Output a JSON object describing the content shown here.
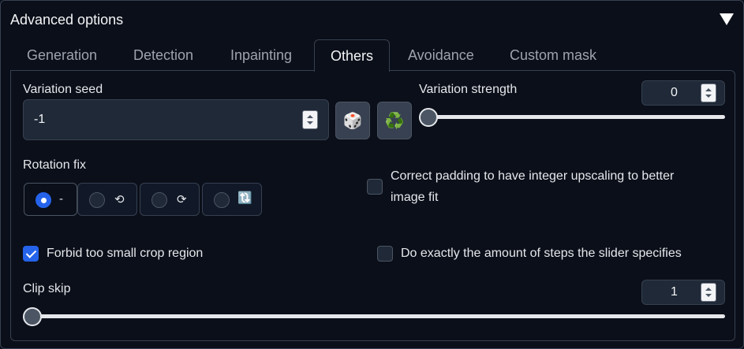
{
  "panel": {
    "title": "Advanced options",
    "collapse_icon": "triangle-down-icon"
  },
  "tabs": [
    {
      "label": "Generation"
    },
    {
      "label": "Detection"
    },
    {
      "label": "Inpainting"
    },
    {
      "label": "Others",
      "active": true
    },
    {
      "label": "Avoidance"
    },
    {
      "label": "Custom mask"
    }
  ],
  "variation_seed": {
    "label": "Variation seed",
    "value": "-1",
    "random_button_icon": "🎲",
    "reuse_button_icon": "♻️"
  },
  "variation_strength": {
    "label": "Variation strength",
    "value": "0",
    "level": 0
  },
  "rotation_fix": {
    "label": "Rotation fix",
    "options": [
      {
        "label": "-",
        "selected": true
      },
      {
        "label": "⟲",
        "selected": false
      },
      {
        "label": "⟳",
        "selected": false
      },
      {
        "label": "🔃",
        "selected": false
      }
    ]
  },
  "correct_padding": {
    "label": "Correct padding to have integer upscaling to better image fit",
    "checked": false
  },
  "forbid_small_crop": {
    "label": "Forbid too small crop region",
    "checked": true
  },
  "exact_steps": {
    "label": "Do exactly the amount of steps the slider specifies",
    "checked": false
  },
  "clip_skip": {
    "label": "Clip skip",
    "value": "1",
    "level": 0
  },
  "colors": {
    "accent": "#2563eb",
    "background": "#0b0f19",
    "border": "#374151"
  }
}
